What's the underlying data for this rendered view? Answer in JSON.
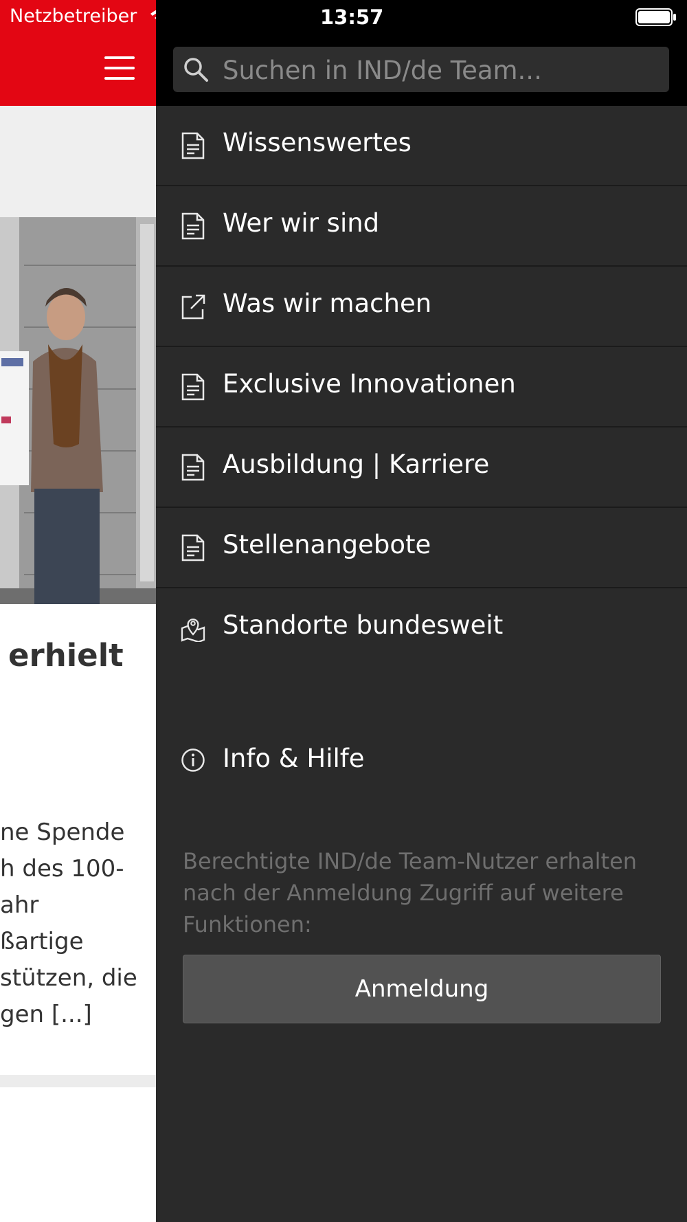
{
  "status_bar": {
    "carrier": "Netzbetreiber",
    "time": "13:57"
  },
  "search": {
    "placeholder": "Suchen in IND/de Team..."
  },
  "menu": {
    "items": [
      {
        "label": "Wissenswertes",
        "icon": "document-icon"
      },
      {
        "label": "Wer wir sind",
        "icon": "document-icon"
      },
      {
        "label": "Was wir machen",
        "icon": "external-link-icon"
      },
      {
        "label": "Exclusive Innovationen",
        "icon": "document-icon"
      },
      {
        "label": "Ausbildung | Karriere",
        "icon": "document-icon"
      },
      {
        "label": "Stellenangebote",
        "icon": "document-icon"
      },
      {
        "label": "Standorte bundesweit",
        "icon": "map-pin-icon"
      }
    ],
    "info": {
      "label": "Info & Hilfe",
      "icon": "info-icon"
    }
  },
  "login": {
    "note": "Berechtigte IND/de Team-Nutzer erhalten nach der Anmeldung Zugriff auf weitere Funktionen:",
    "button_label": "Anmeldung"
  },
  "background_page": {
    "heading_fragment": "erhielt",
    "excerpt_lines": [
      "ne Spende",
      "h des 100-",
      "ahr",
      "ßartige",
      "stützen, die",
      "gen [...]"
    ]
  },
  "colors": {
    "brand_red": "#e30613",
    "drawer_bg": "#2a2a2a",
    "button_bg": "#525252"
  }
}
